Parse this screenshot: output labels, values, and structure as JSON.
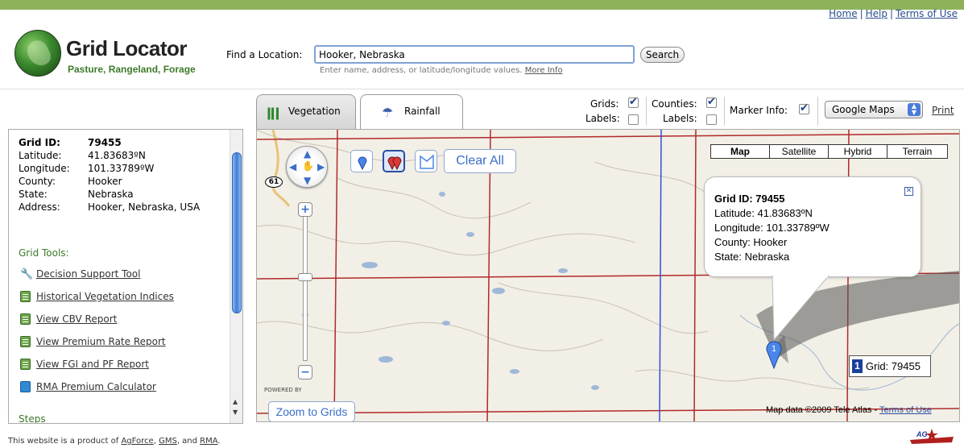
{
  "top_links": {
    "home": "Home",
    "help": "Help",
    "terms": "Terms of Use"
  },
  "logo": {
    "title": "Grid Locator",
    "subtitle": "Pasture, Rangeland, Forage"
  },
  "search": {
    "label": "Find a Location:",
    "value": "Hooker, Nebraska",
    "button": "Search",
    "hint": "Enter name, address, or latitude/longitude values.",
    "more_info": "More Info"
  },
  "tabs": [
    {
      "label": "Vegetation",
      "icon": "grass-icon",
      "active": true
    },
    {
      "label": "Rainfall",
      "icon": "rain-icon",
      "active": false
    }
  ],
  "options": {
    "grids_label": "Grids:",
    "grids_checked": true,
    "grid_labels_label": "Labels:",
    "grid_labels_checked": false,
    "counties_label": "Counties:",
    "counties_checked": true,
    "county_labels_label": "Labels:",
    "county_labels_checked": false,
    "marker_info_label": "Marker Info:",
    "marker_info_checked": true,
    "map_provider": "Google Maps",
    "print": "Print"
  },
  "grid_info": {
    "rows": [
      {
        "key": "Grid ID:",
        "value": "79455"
      },
      {
        "key": "Latitude:",
        "value": "41.83683ºN"
      },
      {
        "key": "Longitude:",
        "value": "101.33789ºW"
      },
      {
        "key": "County:",
        "value": "Hooker"
      },
      {
        "key": "State:",
        "value": "Nebraska"
      },
      {
        "key": "Address:",
        "value": "Hooker, Nebraska, USA"
      }
    ]
  },
  "grid_tools": {
    "heading": "Grid Tools:",
    "items": [
      {
        "label": "Decision Support Tool",
        "icon": "wrench-icon"
      },
      {
        "label": "Historical Vegetation Indices",
        "icon": "sheet-icon"
      },
      {
        "label": "View CBV Report",
        "icon": "sheet-icon"
      },
      {
        "label": "View Premium Rate Report",
        "icon": "sheet-icon"
      },
      {
        "label": "View FGI and PF Report",
        "icon": "sheet-icon"
      },
      {
        "label": "RMA Premium Calculator",
        "icon": "calculator-icon"
      }
    ],
    "steps_heading": "Steps"
  },
  "map": {
    "map_types": [
      "Map",
      "Satellite",
      "Hybrid",
      "Terrain"
    ],
    "selected_map_type": "Map",
    "clear_all": "Clear All",
    "zoom_to_grids": "Zoom to Grids",
    "route_number": "61",
    "powered_by": "POWERED BY",
    "info_bubble": {
      "grid_id_label": "Grid ID:",
      "grid_id": "79455",
      "latitude": "Latitude: 41.83683ºN",
      "longitude": "Longitude: 101.33789ºW",
      "county": "County: Hooker",
      "state": "State: Nebraska"
    },
    "marker_number": "1",
    "grid_label_number": "1",
    "grid_label": "Grid: 79455",
    "attribution": "Map data ©2009 Tele Atlas - ",
    "attribution_link": "Terms of Use"
  },
  "footer": {
    "text_prefix": "This website is a product of ",
    "agforce": "AgForce",
    "comma": ", ",
    "gms": "GMS",
    "and": ", and ",
    "rma": "RMA",
    "period": "."
  },
  "brand_logo_text": "AG"
}
